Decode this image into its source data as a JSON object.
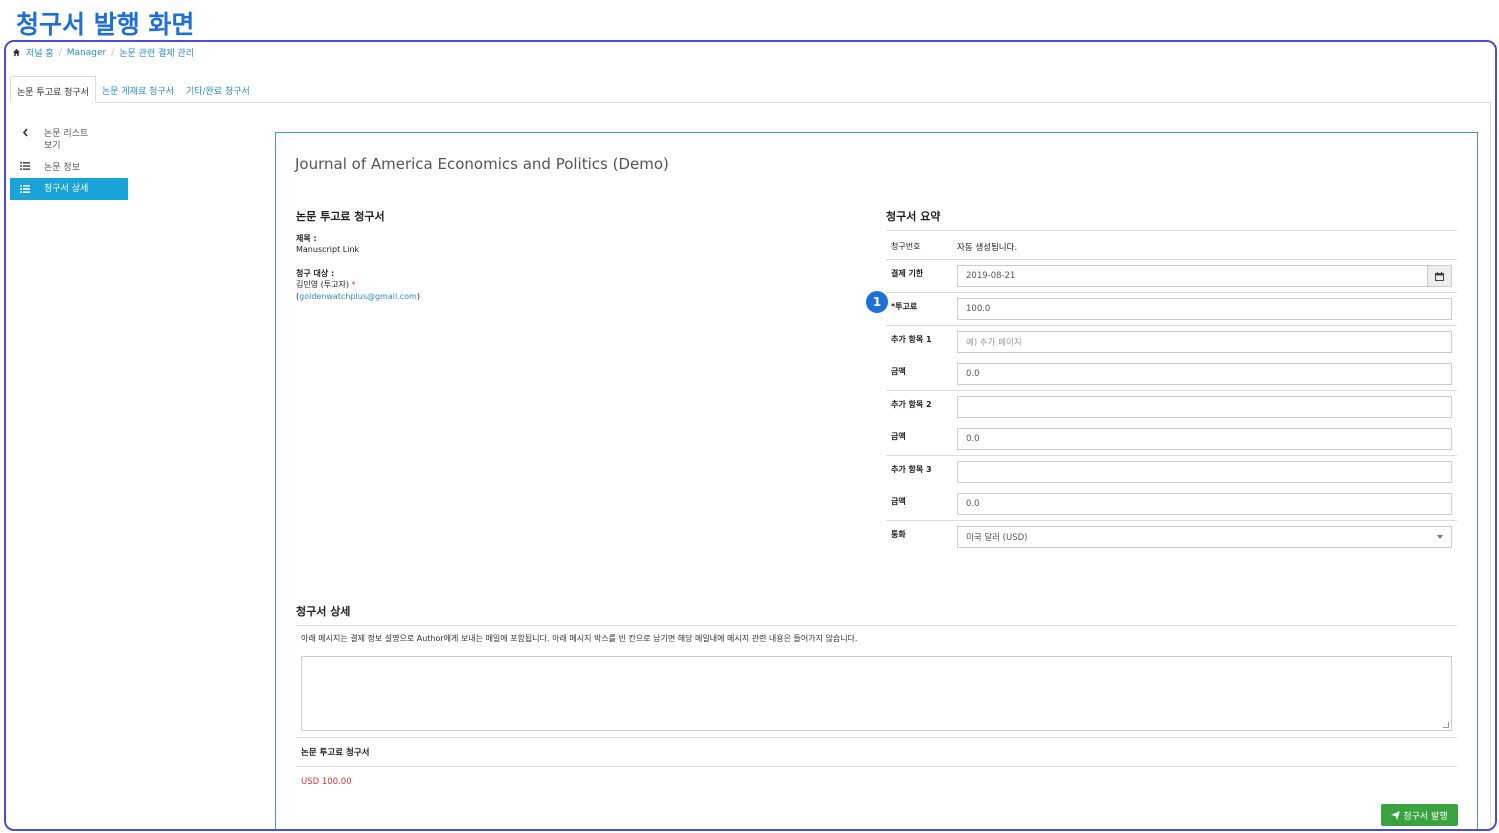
{
  "page_heading": "청구서 발행 화면",
  "breadcrumb": [
    "저널 홈",
    "Manager",
    "논문 관련 결제 관리"
  ],
  "tabs": [
    "논문 투고료 청구서",
    "논문 게재료 청구서",
    "기타/완료 청구서"
  ],
  "sidebar": {
    "back_label_1": "논문 리스트",
    "back_label_2": "보기",
    "items": [
      "논문 정보",
      "청구서 상세"
    ]
  },
  "journal_title": "Journal of America Economics and Politics (Demo)",
  "invoice": {
    "title": "논문 투고료 청구서",
    "subject_label": "제목 :",
    "subject_value": "Manuscript Link",
    "target_label": "청구 대상 :",
    "target_name": "김민영 (투고자)",
    "required_mark": "*",
    "target_email": "goldenwatchplus@gmail.com",
    "email_open": "(",
    "email_close": ")"
  },
  "summary": {
    "title": "청구서 요약",
    "invoice_no_label": "청구번호",
    "invoice_no_value": "자동 생성됩니다.",
    "due_label": "결제 기한",
    "due_value": "2019-08-21",
    "fee_label": "*투고료",
    "fee_value": "100.0",
    "badge": "1",
    "extra1_label": "추가 항목 1",
    "extra1_placeholder": "예) 추가 페이지",
    "amount_label": "금액",
    "amount1_value": "0.0",
    "extra2_label": "추가 항목 2",
    "amount2_value": "0.0",
    "extra3_label": "추가 항목 3",
    "amount3_value": "0.0",
    "currency_label": "통화",
    "currency_value": "미국 달러 (USD)"
  },
  "detail": {
    "title": "청구서 상세",
    "message": "아래 메시지는 결제 정보 설명으로 Author에게 보내는 메일에 포함됩니다. 아래 메시지 박스를 빈 칸으로 남기면 해당 메일내에 메시지 관련 내용은 들어가지 않습니다.",
    "sub_title": "논문 투고료 청구서",
    "amount": "USD 100.00"
  },
  "issue_button": "청구서 발행",
  "colors": {
    "accent": "#1f6fd8",
    "link": "#2a8fc6",
    "active_nav": "#1aa3d9",
    "button": "#3aa33f",
    "danger": "#d33333"
  }
}
